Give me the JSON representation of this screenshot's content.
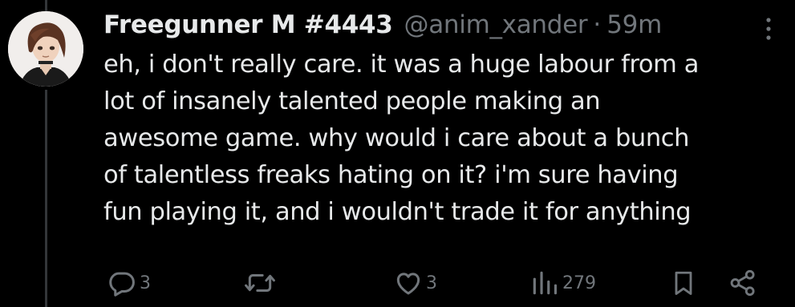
{
  "tweet": {
    "display_name": "Freegunner M #4443",
    "handle": "@anim_xander",
    "separator": "·",
    "time": "59m",
    "lines": [
      "eh, i don't really care. it was a huge labour from a",
      "lot of insanely talented people making an",
      "awesome game. why would i care about a bunch",
      "of talentless freaks hating on it? i'm sure having",
      "fun playing it, and i wouldn't trade it for anything"
    ]
  },
  "actions": {
    "reply_count": "3",
    "like_count": "3",
    "view_count": "279"
  },
  "icons": {
    "reply": "reply-icon",
    "retweet": "retweet-icon",
    "like": "heart-icon",
    "views": "views-icon",
    "bookmark": "bookmark-icon",
    "share": "share-icon",
    "more": "more-icon"
  },
  "colors": {
    "background": "#000000",
    "text": "#e7e9ea",
    "secondary": "#71767b"
  }
}
